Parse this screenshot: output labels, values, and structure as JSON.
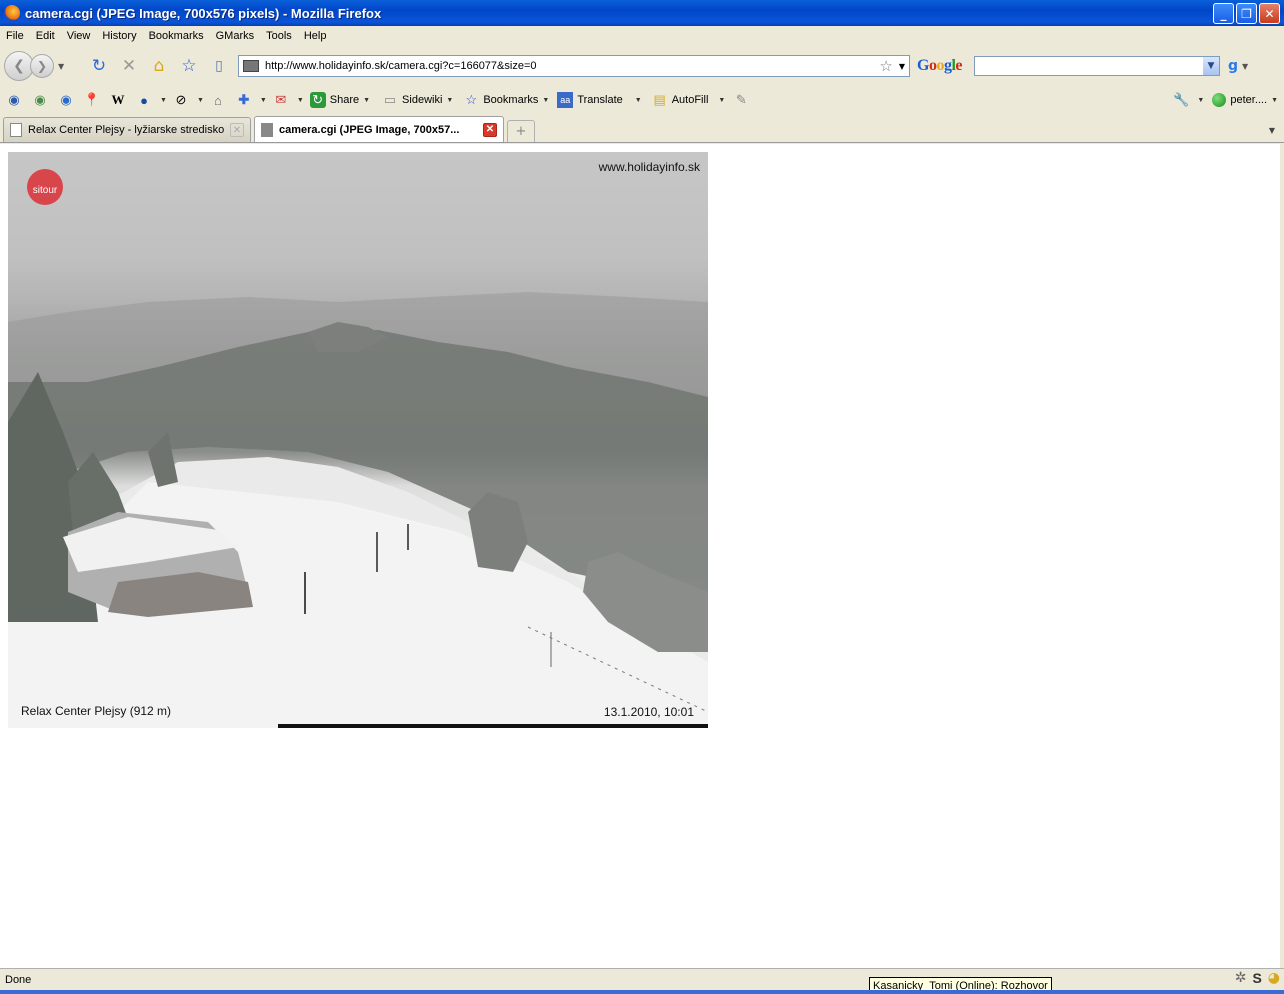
{
  "window": {
    "title": "camera.cgi (JPEG Image, 700x576 pixels) - Mozilla Firefox",
    "buttons": [
      "_",
      "❐",
      "✕"
    ]
  },
  "menu": [
    "File",
    "Edit",
    "View",
    "History",
    "Bookmarks",
    "GMarks",
    "Tools",
    "Help"
  ],
  "navbar": {
    "url": "http://www.holidayinfo.sk/camera.cgi?c=166077&size=0",
    "search_value": ""
  },
  "toolbar": {
    "share": "Share",
    "sidewiki": "Sidewiki",
    "bookmarks": "Bookmarks",
    "translate": "Translate",
    "autofill": "AutoFill",
    "account": "peter...."
  },
  "tabs": [
    {
      "label": "Relax Center Plejsy - lyžiarske stredisko",
      "active": false
    },
    {
      "label": "camera.cgi (JPEG Image, 700x57...",
      "active": true
    }
  ],
  "webcam": {
    "logo_text": "sitour",
    "site": "www.holidayinfo.sk",
    "caption": "Relax Center Plejsy (912 m)",
    "timestamp": "13.1.2010, 10:01"
  },
  "status": {
    "text": "Done",
    "tooltip": "Kasanicky_Tomi (Online): Rozhovor"
  }
}
